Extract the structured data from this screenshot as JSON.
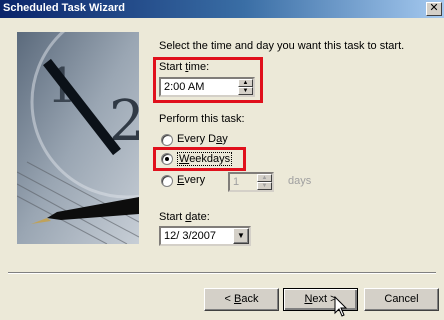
{
  "window": {
    "title": "Scheduled Task Wizard",
    "close_label": "✕"
  },
  "instruction": "Select the time and day you want this task to start.",
  "start_time": {
    "label_pre": "Start ",
    "label_key": "t",
    "label_post": "ime:",
    "value": "2:00 AM"
  },
  "perform": {
    "heading": "Perform this task:",
    "options": [
      {
        "pre": "Every D",
        "key": "a",
        "post": "y",
        "checked": false
      },
      {
        "pre": "",
        "key": "W",
        "post": "eekdays",
        "checked": true
      },
      {
        "pre": "",
        "key": "E",
        "post": "very",
        "checked": false
      }
    ],
    "every_value": "1",
    "every_unit": "days"
  },
  "start_date": {
    "label_pre": "Start ",
    "label_key": "d",
    "label_post": "ate:",
    "value": "12/ 3/2007"
  },
  "buttons": {
    "back_pre": "< ",
    "back_key": "B",
    "back_post": "ack",
    "next_key": "N",
    "next_post": "ext >",
    "cancel": "Cancel"
  },
  "colors": {
    "highlight": "#e0101c",
    "title_bg": "#0a246a",
    "face": "#ece9d8"
  }
}
